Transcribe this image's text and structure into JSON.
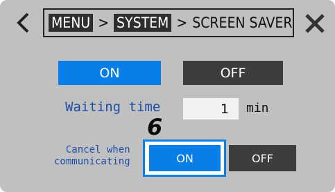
{
  "breadcrumb": {
    "items": [
      "MENU",
      "SYSTEM"
    ],
    "separator": ">",
    "current": "SCREEN SAVER"
  },
  "screen_saver": {
    "on_label": "ON",
    "off_label": "OFF",
    "selected": "ON"
  },
  "waiting_time": {
    "label": "Waiting time",
    "value": "1",
    "unit": "min"
  },
  "cancel_when_communicating": {
    "label_line1": "Cancel when",
    "label_line2": "communicating",
    "on_label": "ON",
    "off_label": "OFF",
    "selected": "ON"
  },
  "step_marker": "6",
  "icons": {
    "back": "chevron-left-icon",
    "close": "close-icon"
  },
  "colors": {
    "background": "#c0c0c0",
    "selected_button": "#0a7ee8",
    "unselected_button": "#3d3d3d",
    "label_text": "#1e4fa8"
  }
}
